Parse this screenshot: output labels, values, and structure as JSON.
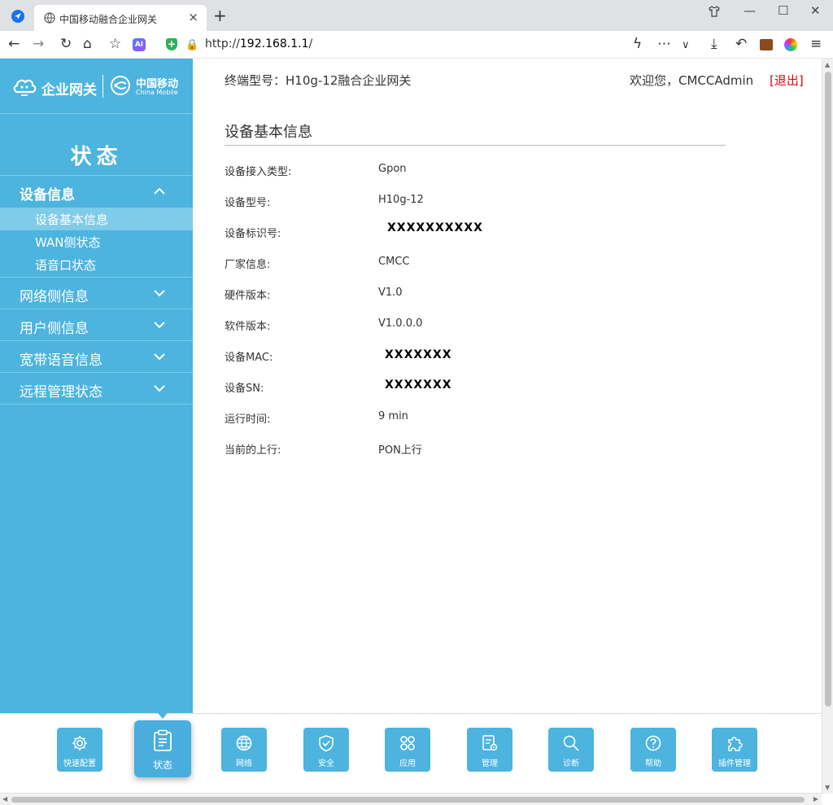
{
  "browser": {
    "tab_title": "中国移动融合企业网关",
    "url_prefix": "http://",
    "url_host": "192.168.1.1",
    "url_suffix": "/",
    "new_tab": "+",
    "tab_close": "×"
  },
  "header": {
    "terminal_model": "终端型号：H10g-12融合企业网关",
    "welcome": "欢迎您，CMCCAdmin",
    "logout": "[退出]"
  },
  "sidebar": {
    "logo_text": "企业网关",
    "logo_brand_cn": "中国移动",
    "logo_brand_en": "China Mobile",
    "section_title": "状态",
    "groups": [
      {
        "label": "设备信息",
        "open": true,
        "items": [
          "设备基本信息",
          "WAN侧状态",
          "语音口状态"
        ]
      },
      {
        "label": "网络侧信息",
        "open": false
      },
      {
        "label": "用户侧信息",
        "open": false
      },
      {
        "label": "宽带语音信息",
        "open": false
      },
      {
        "label": "远程管理状态",
        "open": false
      }
    ]
  },
  "main": {
    "panel_title": "设备基本信息",
    "rows": [
      {
        "label": "设备接入类型:",
        "value": "Gpon"
      },
      {
        "label": "设备型号:",
        "value": "H10g-12"
      },
      {
        "label": "设备标识号:",
        "value": "XXXXXXXXXX"
      },
      {
        "label": "厂家信息:",
        "value": "CMCC"
      },
      {
        "label": "硬件版本:",
        "value": "V1.0"
      },
      {
        "label": "软件版本:",
        "value": "V1.0.0.0"
      },
      {
        "label": "设备MAC:",
        "value": "XXXXXXX"
      },
      {
        "label": "设备SN:",
        "value": "XXXXXXX"
      },
      {
        "label": "运行时间:",
        "value": "9 min"
      },
      {
        "label": "当前的上行:",
        "value": "PON上行"
      }
    ]
  },
  "bottom_nav": [
    {
      "label": "快速配置",
      "icon": "gear-icon"
    },
    {
      "label": "状态",
      "icon": "clipboard-icon",
      "active": true
    },
    {
      "label": "网络",
      "icon": "globe-icon"
    },
    {
      "label": "安全",
      "icon": "shield-icon"
    },
    {
      "label": "应用",
      "icon": "apps-icon"
    },
    {
      "label": "管理",
      "icon": "manage-icon"
    },
    {
      "label": "诊断",
      "icon": "search-icon"
    },
    {
      "label": "帮助",
      "icon": "help-icon"
    },
    {
      "label": "插件管理",
      "icon": "puzzle-icon"
    }
  ],
  "colors": {
    "sidebar": "#4cb4df",
    "sidebar_active_item": "#7fcbea",
    "logout": "#e60012",
    "text": "#333333"
  }
}
